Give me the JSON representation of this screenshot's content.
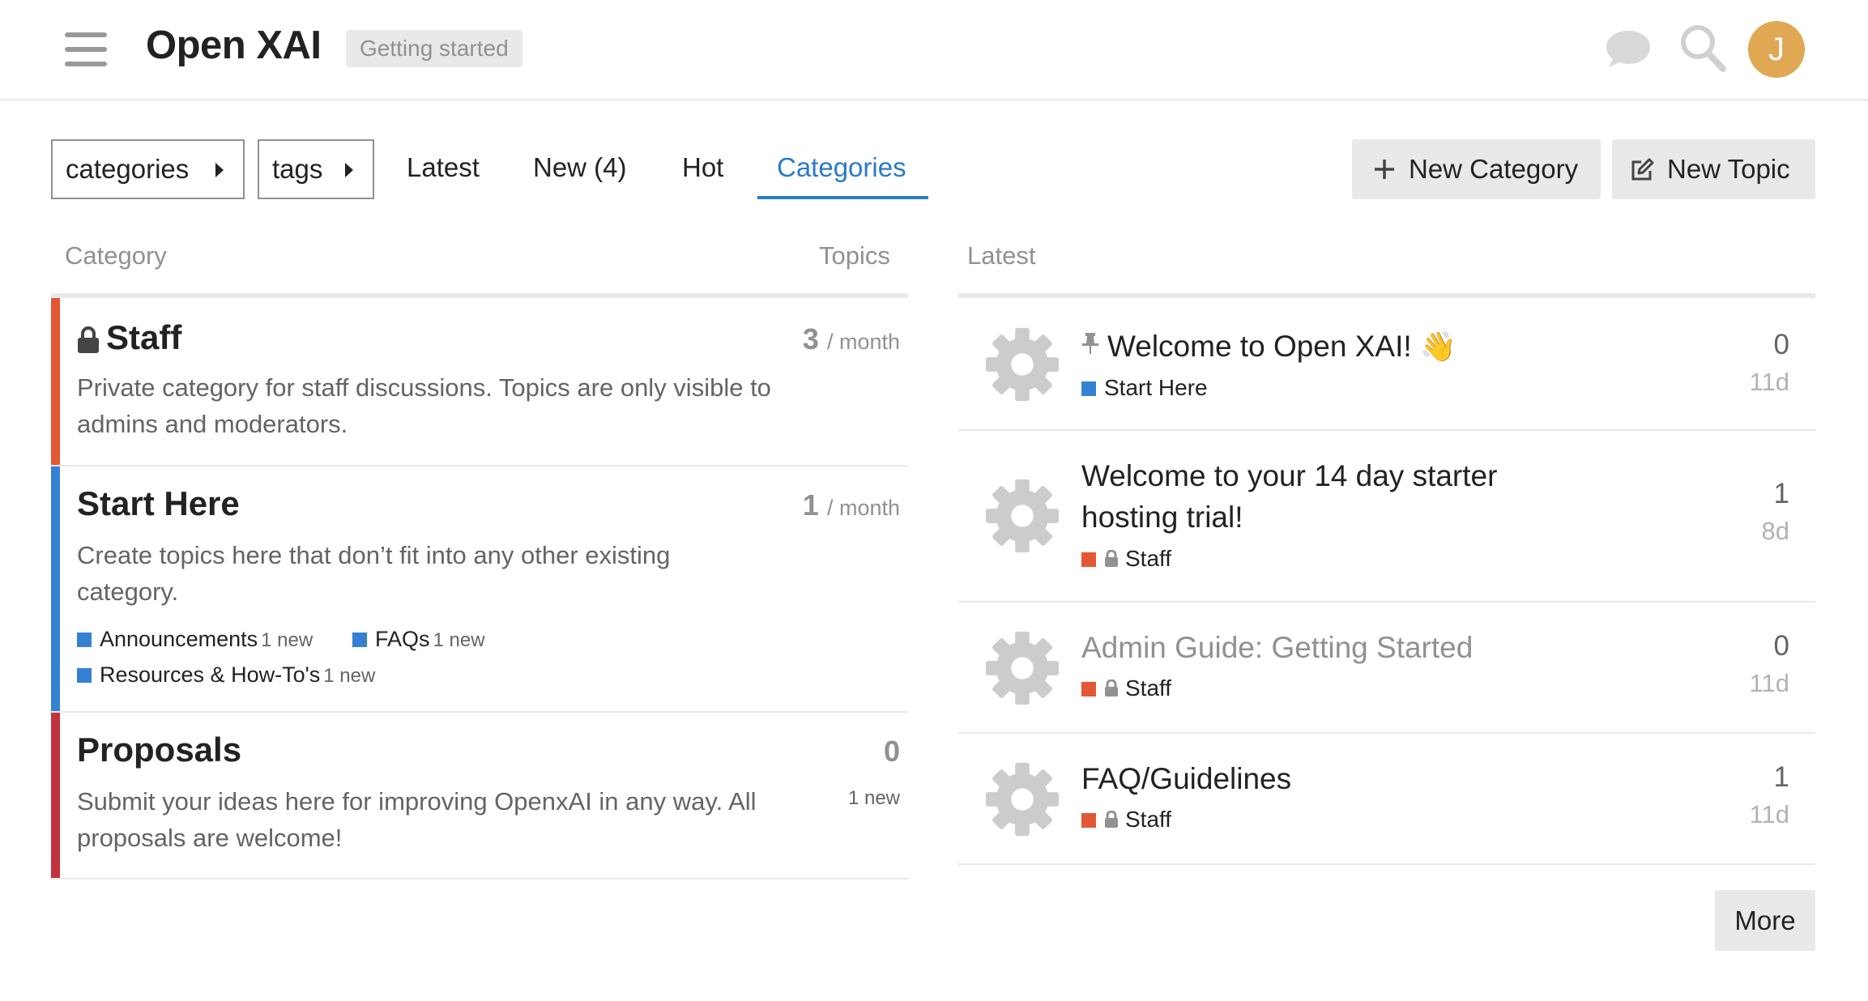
{
  "header": {
    "site_title": "Open XAI",
    "badge": "Getting started",
    "avatar_letter": "J",
    "avatar_color": "#e0a852"
  },
  "nav": {
    "categories_dropdown": "categories",
    "tags_dropdown": "tags",
    "links": [
      "Latest",
      "New (4)",
      "Hot",
      "Categories"
    ],
    "active": "Categories",
    "new_category_button": "New Category",
    "new_topic_button": "New Topic"
  },
  "categories_table": {
    "col_category": "Category",
    "col_topics": "Topics",
    "rows": [
      {
        "name": "Staff",
        "locked": true,
        "color": "#e45735",
        "description": "Private category for staff discussions. Topics are only visible to admins and moderators.",
        "count": "3",
        "per": "/ month"
      },
      {
        "name": "Start Here",
        "locked": false,
        "color": "#3481d4",
        "description": "Create topics here that don’t fit into any other existing category.",
        "count": "1",
        "per": "/ month",
        "subcategories": [
          {
            "name": "Announcements",
            "new": "1 new",
            "color": "#3481d4"
          },
          {
            "name": "FAQs",
            "new": "1 new",
            "color": "#3481d4"
          },
          {
            "name": "Resources & How-To's",
            "new": "1 new",
            "color": "#3481d4"
          }
        ]
      },
      {
        "name": "Proposals",
        "locked": false,
        "color": "#c3313b",
        "description": "Submit your ideas here for improving OpenxAI in any way. All proposals are welcome!",
        "count": "0",
        "new": "1 new"
      }
    ]
  },
  "latest": {
    "header": "Latest",
    "topics": [
      {
        "title": "Welcome to Open XAI!",
        "emoji": "👋",
        "pinned": true,
        "category": "Start Here",
        "category_color": "#3481d4",
        "locked": false,
        "posts": "0",
        "age": "11d",
        "read": false
      },
      {
        "title": "Welcome to your 14 day starter hosting trial!",
        "pinned": false,
        "category": "Staff",
        "category_color": "#e45735",
        "locked": true,
        "posts": "1",
        "age": "8d",
        "read": false
      },
      {
        "title": "Admin Guide: Getting Started",
        "pinned": false,
        "category": "Staff",
        "category_color": "#e45735",
        "locked": true,
        "posts": "0",
        "age": "11d",
        "read": true
      },
      {
        "title": "FAQ/Guidelines",
        "pinned": false,
        "category": "Staff",
        "category_color": "#e45735",
        "locked": true,
        "posts": "1",
        "age": "11d",
        "read": false
      }
    ],
    "more_button": "More"
  },
  "icons": [
    "hamburger-icon",
    "chat-icon",
    "search-icon",
    "caret-right-icon",
    "plus-icon",
    "edit-icon",
    "lock-icon",
    "pin-icon",
    "gear-avatar-icon"
  ]
}
